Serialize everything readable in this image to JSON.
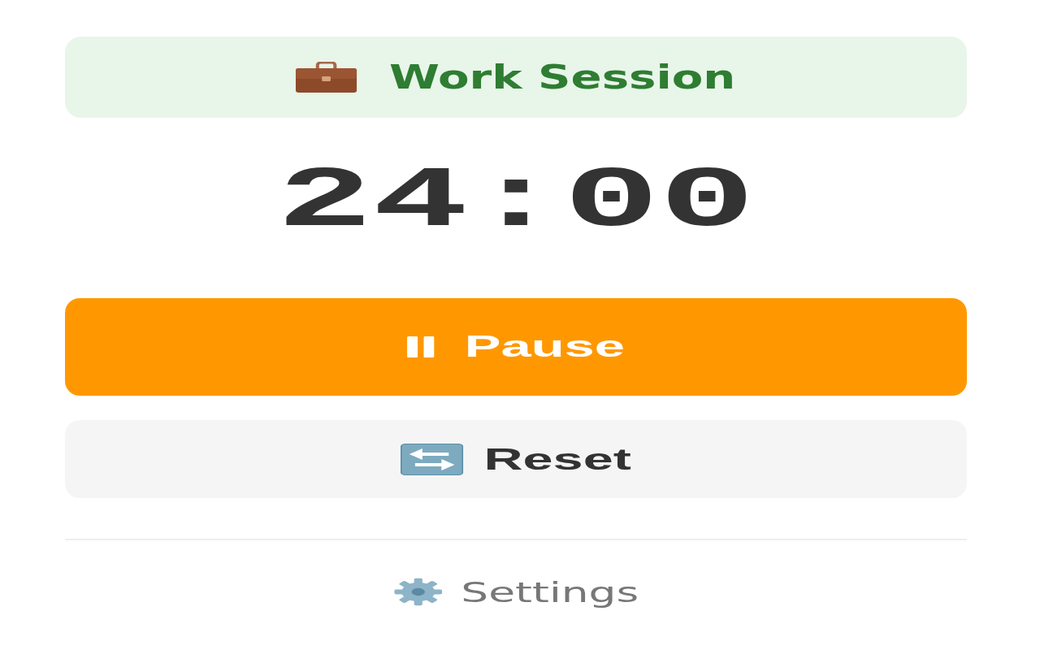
{
  "session": {
    "label": "Work Session"
  },
  "timer": "24:00",
  "buttons": [
    {
      "kind": "pause",
      "label": "Pause"
    },
    {
      "kind": "reset",
      "label": "Reset"
    }
  ],
  "settings": {
    "label": "Settings"
  }
}
